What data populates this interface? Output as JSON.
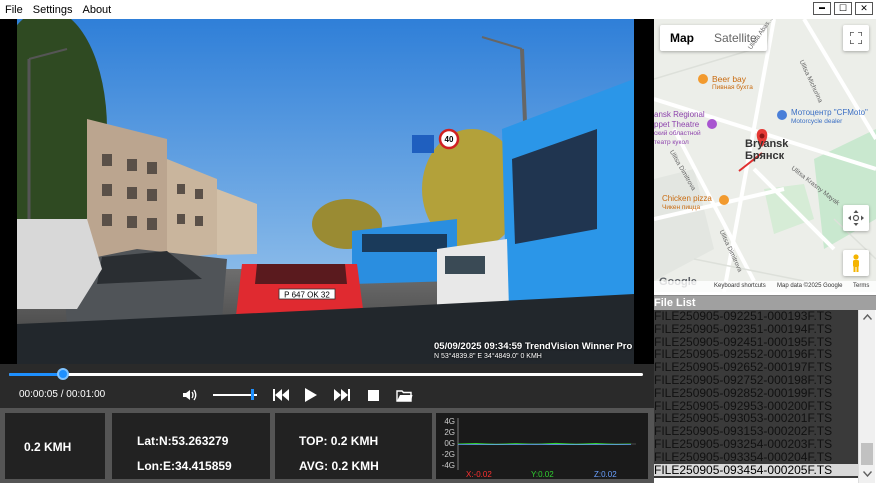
{
  "menu": {
    "file": "File",
    "settings": "Settings",
    "about": "About"
  },
  "window_controls": {
    "minimize": "▬",
    "maximize": "☐",
    "close": "✕"
  },
  "video": {
    "osd_datetime_brand": "05/09/2025 09:34:59  TrendVision Winner Pro",
    "osd_coords": "N 53°4839.8\"  E   34°4849.0\"   0 KMH",
    "speed_sign": "40",
    "plate": "P 647 OK 32"
  },
  "player": {
    "time": "00:00:05 / 00:01:00",
    "progress_fraction": 0.085,
    "volume_fraction": 0.88,
    "buttons": [
      "volume",
      "prev",
      "play",
      "next",
      "stop",
      "open-folder"
    ]
  },
  "info": {
    "speed": "0.2 KMH",
    "lat": "Lat:N:53.263279",
    "lon": "Lon:E:34.415859",
    "top": "TOP: 0.2 KMH",
    "avg": "AVG: 0.2 KMH"
  },
  "gsensor": {
    "ticks": [
      "4G",
      "2G",
      "0G",
      "-2G",
      "-4G"
    ],
    "x_label": "X:-0.02",
    "y_label": "Y:0.02",
    "z_label": "Z:0.02",
    "colors": {
      "x": "#ff3030",
      "y": "#30d030",
      "z": "#6aa0ff"
    }
  },
  "map": {
    "tab_map": "Map",
    "tab_satellite": "Satellite",
    "labels": {
      "beer_bay": "Beer bay",
      "beer_bay_ru": "Пивная бухта",
      "theatre1": "ansk Regional",
      "theatre2": "ppet Theatre",
      "theatre3": "ский областной",
      "theatre4": "театр кукол",
      "moto1": "Мотоцентр \"CFMoto\"",
      "moto2": "Motorcycle dealer",
      "city_en": "Bryansk",
      "city_ru": "Брянск",
      "chicken1": "Chicken pizza",
      "chicken2": "Чикен пицца",
      "street_abas": "Ulitsa Abas...",
      "street_michurina": "Ulitsa Michurina",
      "street_dimitrova": "Ulitsa Dimitrova",
      "street_dimitrova2": "Ulitsa Dimitrova",
      "street_krasny": "Ulitsa Krasny Mayak"
    },
    "footer_shortcuts": "Keyboard shortcuts",
    "footer_data": "Map data ©2025 Google",
    "footer_terms": "Terms",
    "google": "Google"
  },
  "filelist": {
    "title": "File List",
    "files": [
      "FILE250905-092251-000193F.TS",
      "FILE250905-092351-000194F.TS",
      "FILE250905-092451-000195F.TS",
      "FILE250905-092552-000196F.TS",
      "FILE250905-092652-000197F.TS",
      "FILE250905-092752-000198F.TS",
      "FILE250905-092852-000199F.TS",
      "FILE250905-092953-000200F.TS",
      "FILE250905-093053-000201F.TS",
      "FILE250905-093153-000202F.TS",
      "FILE250905-093254-000203F.TS",
      "FILE250905-093354-000204F.TS",
      "FILE250905-093454-000205F.TS"
    ],
    "selected_index": 12
  }
}
